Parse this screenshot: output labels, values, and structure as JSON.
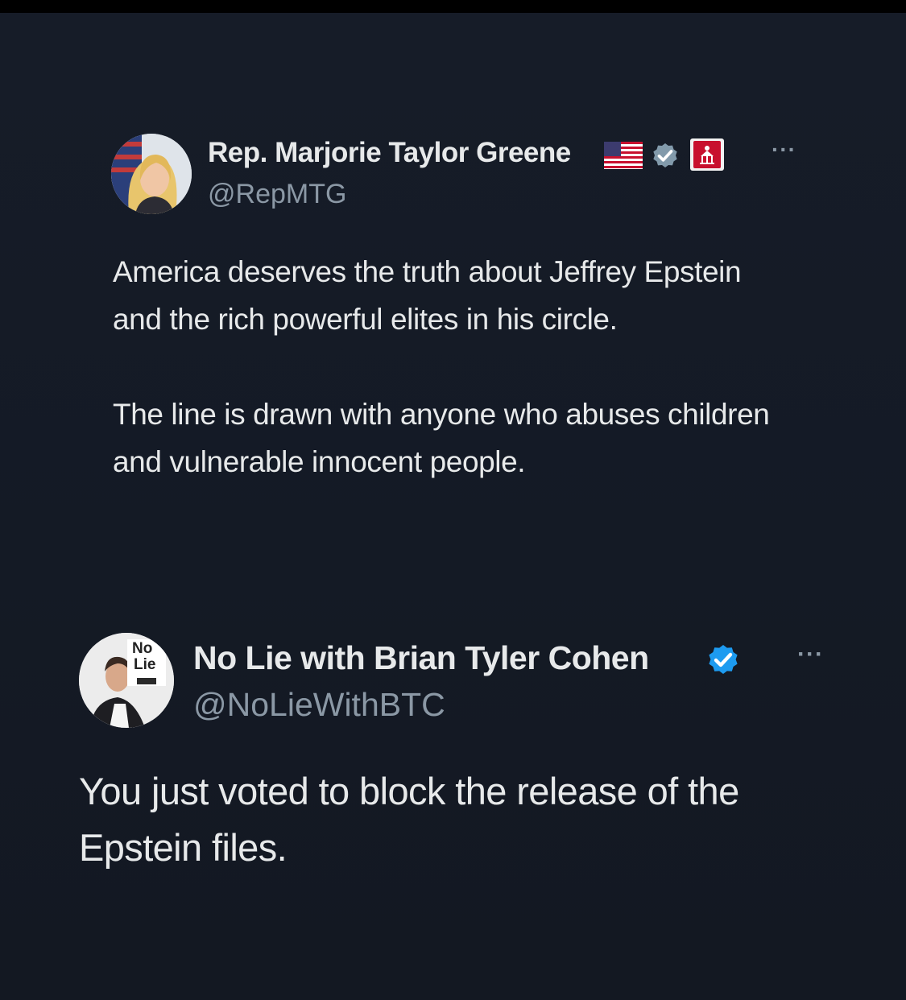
{
  "tweet1": {
    "display_name": "Rep. Marjorie Taylor Greene",
    "handle": "@RepMTG",
    "paragraph1": "America deserves the truth about Jeffrey Epstein and the rich powerful elites in his circle.",
    "paragraph2": "The line is drawn with anyone who abuses children and vulnerable innocent people.",
    "more": "···",
    "badges": [
      "us-flag-icon",
      "gray-verified-icon",
      "government-affiliation-icon"
    ]
  },
  "tweet2": {
    "display_name": "No Lie with Brian Tyler Cohen",
    "handle": "@NoLieWithBTC",
    "text": "You just voted to block the release of the Epstein files.",
    "more": "···",
    "badges": [
      "blue-verified-icon"
    ],
    "avatar_badge_line1": "No",
    "avatar_badge_line2": "Lie"
  },
  "colors": {
    "background": "#151b26",
    "text": "#e7e9ea",
    "secondary": "#8b98a5",
    "verified_blue": "#1d9bf0",
    "verified_gray": "#829aab",
    "gov_red": "#c8102e"
  }
}
